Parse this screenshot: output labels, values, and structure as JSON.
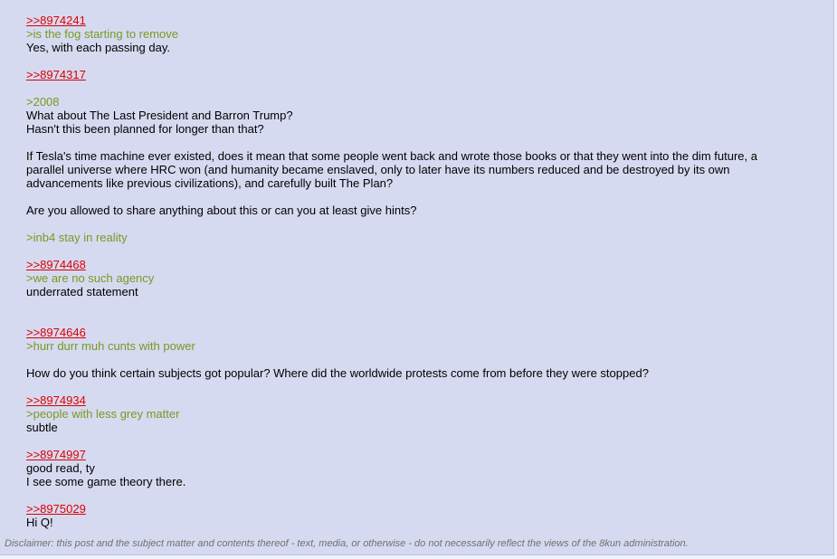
{
  "post": {
    "lines": [
      {
        "type": "link",
        "text": ">>8974241"
      },
      {
        "type": "green",
        "text": ">is the fog starting to remove"
      },
      {
        "type": "text",
        "text": "Yes, with each passing day."
      },
      {
        "type": "blank",
        "text": ""
      },
      {
        "type": "link",
        "text": ">>8974317"
      },
      {
        "type": "blank",
        "text": ""
      },
      {
        "type": "green",
        "text": ">2008"
      },
      {
        "type": "text",
        "text": "What about The Last President and Barron Trump?"
      },
      {
        "type": "text",
        "text": "Hasn't this been planned for longer than that?"
      },
      {
        "type": "blank",
        "text": ""
      },
      {
        "type": "text",
        "text": "If Tesla's time machine ever existed, does it mean that some people went back and wrote those books or that they went into the dim future, a"
      },
      {
        "type": "text",
        "text": "parallel universe where HRC won (and humanity became enslaved, only to later have its numbers reduced and be destroyed by its own"
      },
      {
        "type": "text",
        "text": "advancements like previous civilizations), and carefully built The Plan?"
      },
      {
        "type": "blank",
        "text": ""
      },
      {
        "type": "text",
        "text": "Are you allowed to share anything about this or can you at least give hints?"
      },
      {
        "type": "blank",
        "text": ""
      },
      {
        "type": "green",
        "text": ">inb4 stay in reality"
      },
      {
        "type": "blank",
        "text": ""
      },
      {
        "type": "link",
        "text": ">>8974468"
      },
      {
        "type": "green",
        "text": ">we are no such agency"
      },
      {
        "type": "text",
        "text": "underrated statement"
      },
      {
        "type": "blank",
        "text": ""
      },
      {
        "type": "blank",
        "text": ""
      },
      {
        "type": "link",
        "text": ">>8974646"
      },
      {
        "type": "green",
        "text": ">hurr durr muh cunts with power"
      },
      {
        "type": "blank",
        "text": ""
      },
      {
        "type": "text",
        "text": "How do you think certain subjects got popular? Where did the worldwide protests come from before they were stopped?"
      },
      {
        "type": "blank",
        "text": ""
      },
      {
        "type": "link",
        "text": ">>8974934"
      },
      {
        "type": "green",
        "text": ">people with less grey matter"
      },
      {
        "type": "text",
        "text": "subtle"
      },
      {
        "type": "blank",
        "text": ""
      },
      {
        "type": "link",
        "text": ">>8974997"
      },
      {
        "type": "text",
        "text": "good read, ty"
      },
      {
        "type": "text",
        "text": "I see some game theory there."
      },
      {
        "type": "blank",
        "text": ""
      },
      {
        "type": "link",
        "text": ">>8975029"
      },
      {
        "type": "text",
        "text": "Hi Q!"
      }
    ]
  },
  "disclaimer": "Disclaimer: this post and the subject matter and contents thereof - text, media, or otherwise - do not necessarily reflect the views of the 8kun administration.",
  "colors": {
    "post_bg": "#d6daf0",
    "link": "#dd0000",
    "greentext": "#789922",
    "disclaimer": "#707070"
  }
}
